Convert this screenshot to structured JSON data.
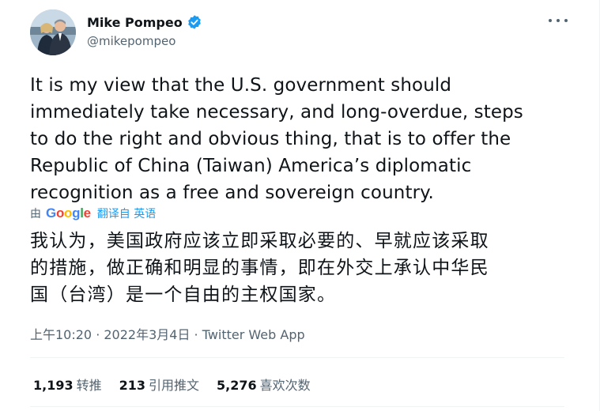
{
  "author": {
    "name": "Mike Pompeo",
    "handle": "@mikepompeo",
    "verified_color": "#1d9bf0"
  },
  "tweet": {
    "lines": [
      "It is my view that the U.S. government should",
      "immediately take necessary, and long-overdue, steps",
      "to do the right and obvious thing, that is to offer the",
      "Republic of China (Taiwan) America’s diplomatic",
      "recognition as a free and sovereign country."
    ]
  },
  "translation": {
    "by_label": "由",
    "provider": "Google",
    "action_label": "翻译自 英语",
    "lines": [
      "我认为，美国政府应该立即采取必要的、早就应该采取",
      "的措施，做正确和明显的事情，即在外交上承认中华民",
      "国（台湾）是一个自由的主权国家。"
    ]
  },
  "meta": {
    "text": "上午10:20 · 2022年3月4日 · Twitter Web App"
  },
  "stats": {
    "retweets_count": "1,193",
    "retweets_label": "转推",
    "quotes_count": "213",
    "quotes_label": "引用推文",
    "likes_count": "5,276",
    "likes_label": "喜欢次数"
  },
  "icons": {
    "verified": "verified-badge-icon",
    "more": "more-options-icon"
  }
}
